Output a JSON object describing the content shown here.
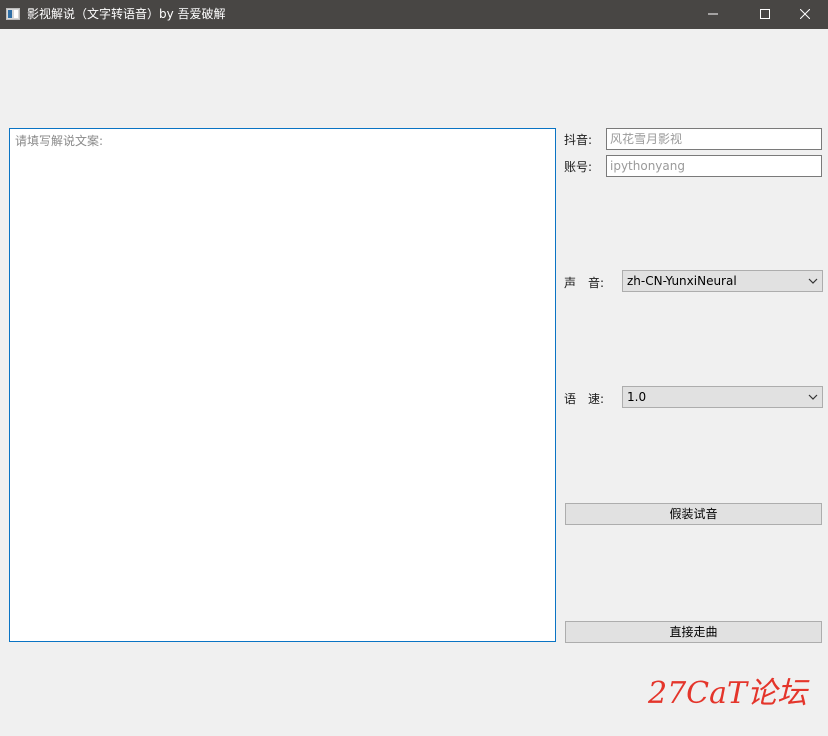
{
  "window": {
    "title": "影视解说（文字转语音）by 吾爱破解"
  },
  "editor": {
    "placeholder": "请填写解说文案:"
  },
  "form": {
    "douyin_label": "抖音:",
    "douyin_placeholder": "风花雪月影视",
    "account_label": "账号:",
    "account_placeholder": "ipythonyang",
    "voice_label": "声　音:",
    "voice_value": "zh-CN-YunxiNeural",
    "speed_label": "语　速:",
    "speed_value": "1.0",
    "preview_button": "假装试音",
    "run_button": "直接走曲"
  },
  "watermark": {
    "text": "27CaT论坛",
    "color": "#e4352b"
  },
  "colors": {
    "titlebar": "#484644",
    "focus_border": "#0a74c4",
    "background": "#f0f0f0"
  }
}
